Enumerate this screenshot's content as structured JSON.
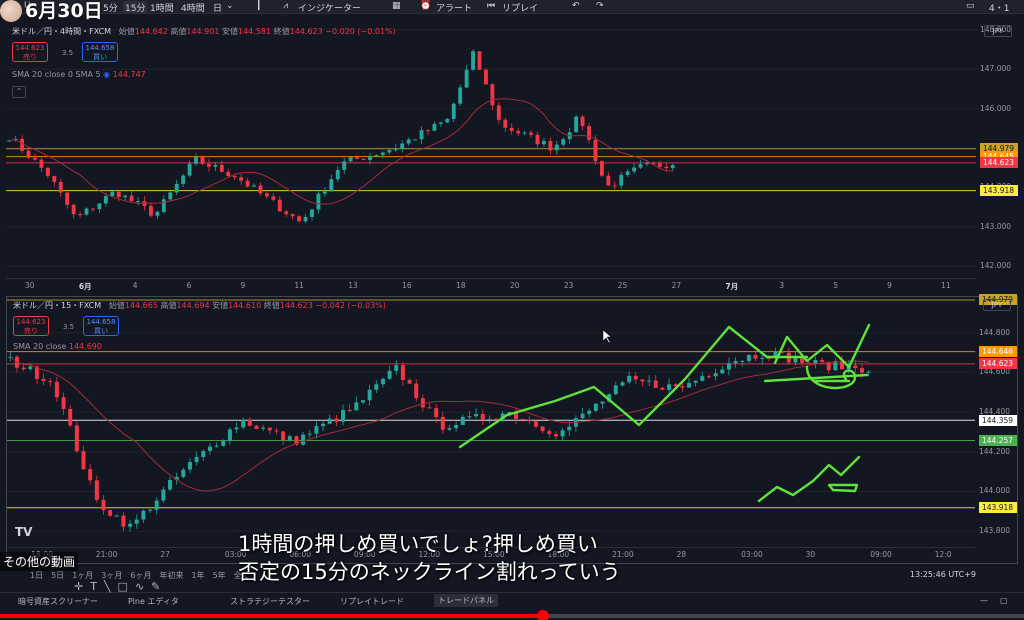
{
  "header": {
    "date_title": "6月30日",
    "symbol_fragment": "U",
    "intervals": [
      "5分",
      "15分",
      "1時間",
      "4時間",
      "日"
    ],
    "active_interval": "15分",
    "indicators_label": "インジケーター",
    "alert_label": "アラート",
    "replay_label": "リプレイ",
    "right_counter": "4・1"
  },
  "top_pane": {
    "symbol": "米ドル／円・4時間・FXCM",
    "ohlc": {
      "o_label": "始値",
      "o": "144.642",
      "h_label": "高値",
      "h": "144.901",
      "l_label": "安値",
      "l": "144.581",
      "c_label": "終値",
      "c": "144.623",
      "chg": "−0.020 (−0.01%)"
    },
    "sell": {
      "price": "144.623",
      "label": "売り"
    },
    "spread": "3.5",
    "buy": {
      "price": "144.658",
      "label": "買い"
    },
    "sma_label": "SMA 20 close 0 SMA 5",
    "sma_value": "144.747",
    "currency": "JPY",
    "price_ticks": [
      "148.000",
      "147.000",
      "146.000",
      "145.000",
      "144.000",
      "143.000",
      "142.000"
    ],
    "price_range": [
      141.7,
      148.35
    ],
    "price_labels": [
      {
        "value": "144.979",
        "price": 144.979,
        "color": "#c9a227",
        "text_color": "#131722"
      },
      {
        "value": "144.645",
        "price": 144.78,
        "color": "#ff9800",
        "text_color": "#ffffff"
      },
      {
        "value": "144.623",
        "price": 144.623,
        "color": "#f23645",
        "text_color": "#ffffff"
      },
      {
        "value": "143.918",
        "price": 143.918,
        "color": "#ffeb3b",
        "text_color": "#131722"
      }
    ],
    "time_ticks": [
      "30",
      "6月",
      "4",
      "6",
      "9",
      "11",
      "13",
      "16",
      "18",
      "20",
      "23",
      "25",
      "27",
      "7月",
      "3",
      "5",
      "9",
      "11"
    ]
  },
  "bottom_pane": {
    "symbol": "米ドル／円・15・FXCM",
    "ohlc": {
      "o_label": "始値",
      "o": "144.665",
      "h_label": "高値",
      "h": "144.694",
      "l_label": "安値",
      "l": "144.610",
      "c_label": "終値",
      "c": "144.623",
      "chg": "−0.042 (−0.03%)"
    },
    "sell": {
      "price": "144.623",
      "label": "売り"
    },
    "spread": "3.5",
    "buy": {
      "price": "144.658",
      "label": "買い"
    },
    "sma_label": "SMA 20 close",
    "sma_value": "144.690",
    "currency": "JPY",
    "price_ticks": [
      "144.800",
      "144.600",
      "144.400",
      "144.200",
      "144.000",
      "143.800"
    ],
    "price_range": [
      143.72,
      144.98
    ],
    "price_labels": [
      {
        "value": "144.979",
        "price": 144.965,
        "color": "#c9a227",
        "text_color": "#131722"
      },
      {
        "value": "144.646",
        "price": 144.705,
        "color": "#ff9800",
        "text_color": "#ffffff"
      },
      {
        "value": "144.623",
        "price": 144.643,
        "color": "#f23645",
        "text_color": "#ffffff"
      },
      {
        "value": "144.359",
        "price": 144.359,
        "color": "#ffffff",
        "text_color": "#131722"
      },
      {
        "value": "144.257",
        "price": 144.257,
        "color": "#4caf50",
        "text_color": "#ffffff"
      },
      {
        "value": "143.918",
        "price": 143.918,
        "color": "#ffeb3b",
        "text_color": "#131722"
      }
    ],
    "time_ticks": [
      "18:00",
      "21:00",
      "27",
      "03:00",
      "06:00",
      "09:00",
      "12:00",
      "15:00",
      "18:00",
      "21:00",
      "28",
      "03:00",
      "30",
      "09:00",
      "12:0"
    ]
  },
  "subtitles": {
    "line1": "1時間の押しめ買いでしょ?押しめ買い",
    "line2": "否定の15分のネックライン割れっていう"
  },
  "overlay": {
    "other_videos": "その他の動画"
  },
  "footer": {
    "timeframes": [
      "1日",
      "5日",
      "1ヶ月",
      "3ヶ月",
      "6ヶ月",
      "年初来",
      "1年",
      "5年",
      "全て"
    ],
    "clock": "13:25:46 UTC+9",
    "panel_tabs": [
      "暗号資産スクリーナー",
      "Pine エディタ",
      "ストラテジーテスター",
      "リプレイトレード",
      "トレードパネル"
    ],
    "active_tab": "トレードパネル"
  },
  "video": {
    "progress_fraction": 0.53
  },
  "colors": {
    "up": "#26a69a",
    "down": "#f23645",
    "sma": "#a52a3a",
    "drawing": "#5fe23c"
  }
}
